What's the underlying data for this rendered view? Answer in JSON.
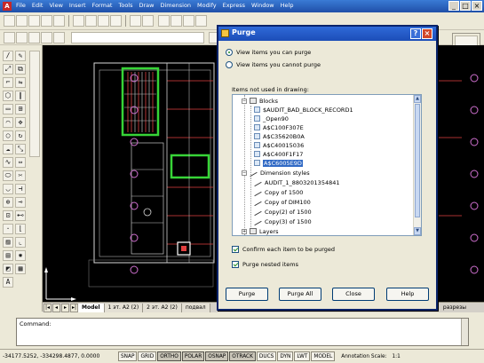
{
  "app": {
    "menu": [
      "File",
      "Edit",
      "View",
      "Insert",
      "Format",
      "Tools",
      "Draw",
      "Dimension",
      "Modify",
      "Express",
      "Window",
      "Help"
    ]
  },
  "tabs": {
    "items": [
      "Model",
      "1 эт. А2 (2)",
      "2 эт. А2 (2)",
      "подвал"
    ],
    "right_label": "разрезы"
  },
  "command": {
    "label": "Command:"
  },
  "status": {
    "coords": "-34177.5252, -334298.4877, 0.0000",
    "buttons": [
      "SNAP",
      "GRID",
      "ORTHO",
      "POLAR",
      "OSNAP",
      "OTRACK",
      "DUCS",
      "DYN",
      "LWT",
      "MODEL"
    ],
    "annotation_scale_label": "Annotation Scale:",
    "annotation_scale_value": "1:1"
  },
  "dialog": {
    "title": "Purge",
    "radio_can_purge": "View items you can purge",
    "radio_cannot_purge": "View items you cannot purge",
    "group_label": "Items not used in drawing:",
    "tree": {
      "blocks_label": "Blocks",
      "blocks": [
        "$AUDIT_BAD_BLOCK_RECORD1",
        "_Open90",
        "A$C100F307E",
        "A$C35620B0A",
        "A$C40015036",
        "A$C400F1F17",
        "A$C6005E9D"
      ],
      "selected_block_index": 6,
      "dimstyles_label": "Dimension styles",
      "dimstyles": [
        "AUDIT_1_8803201354841",
        "Copy of 1500",
        "Copy of DIM100",
        "Copy(2) of 1500",
        "Copy(3) of 1500"
      ],
      "layers_label": "Layers"
    },
    "check_confirm": "Confirm each item to be purged",
    "check_nested": "Purge nested items",
    "buttons": {
      "purge": "Purge",
      "purge_all": "Purge All",
      "close": "Close",
      "help": "Help"
    },
    "help_glyph": "?",
    "close_glyph": "×"
  },
  "colors": {
    "canvas_bg": "#000000",
    "dialog_title": "#1c4db8",
    "selection": "#316ac5"
  }
}
